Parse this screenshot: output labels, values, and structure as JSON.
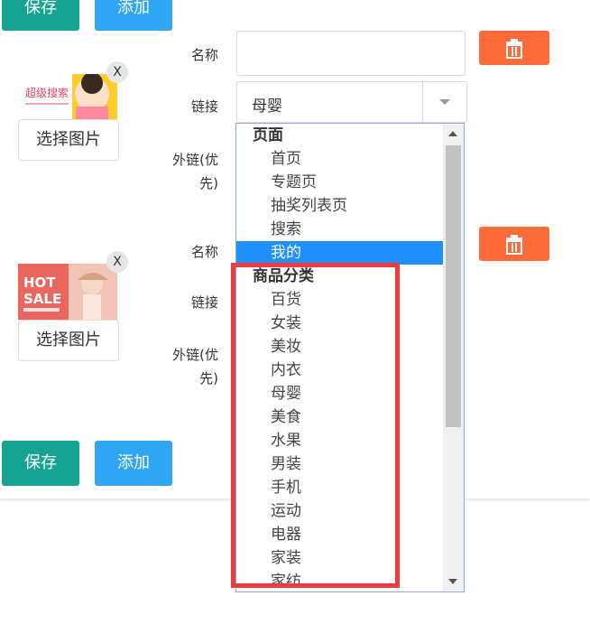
{
  "toolbar_top": {
    "save_label": "保存",
    "add_label": "添加"
  },
  "toolbar_bottom": {
    "save_label": "保存",
    "add_label": "添加"
  },
  "rows": [
    {
      "thumb_text": "超级搜索",
      "close_label": "X",
      "pick_label": "选择图片",
      "name_label": "名称",
      "link_label": "链接",
      "link_value": "母婴",
      "ext_label_line1": "外链(优",
      "ext_label_line2": "先)"
    },
    {
      "thumb_text_1": "HOT",
      "thumb_text_2": "SALE",
      "close_label": "X",
      "pick_label": "选择图片",
      "name_label": "名称",
      "link_label": "链接",
      "ext_label_line1": "外链(优",
      "ext_label_line2": "先)"
    }
  ],
  "dropdown": {
    "group_page": "页面",
    "page_items": [
      "首页",
      "专题页",
      "抽奖列表页",
      "搜索",
      "我的"
    ],
    "selected": "我的",
    "group_category": "商品分类",
    "category_items": [
      "百货",
      "女装",
      "美妆",
      "内衣",
      "母婴",
      "美食",
      "水果",
      "男装",
      "手机",
      "运动",
      "电器",
      "家装",
      "家纺"
    ]
  },
  "colors": {
    "save": "#17a392",
    "add": "#2ea6f3",
    "delete": "#ff6a39",
    "selected": "#1e90ff",
    "annotation": "#ef3b3b"
  }
}
